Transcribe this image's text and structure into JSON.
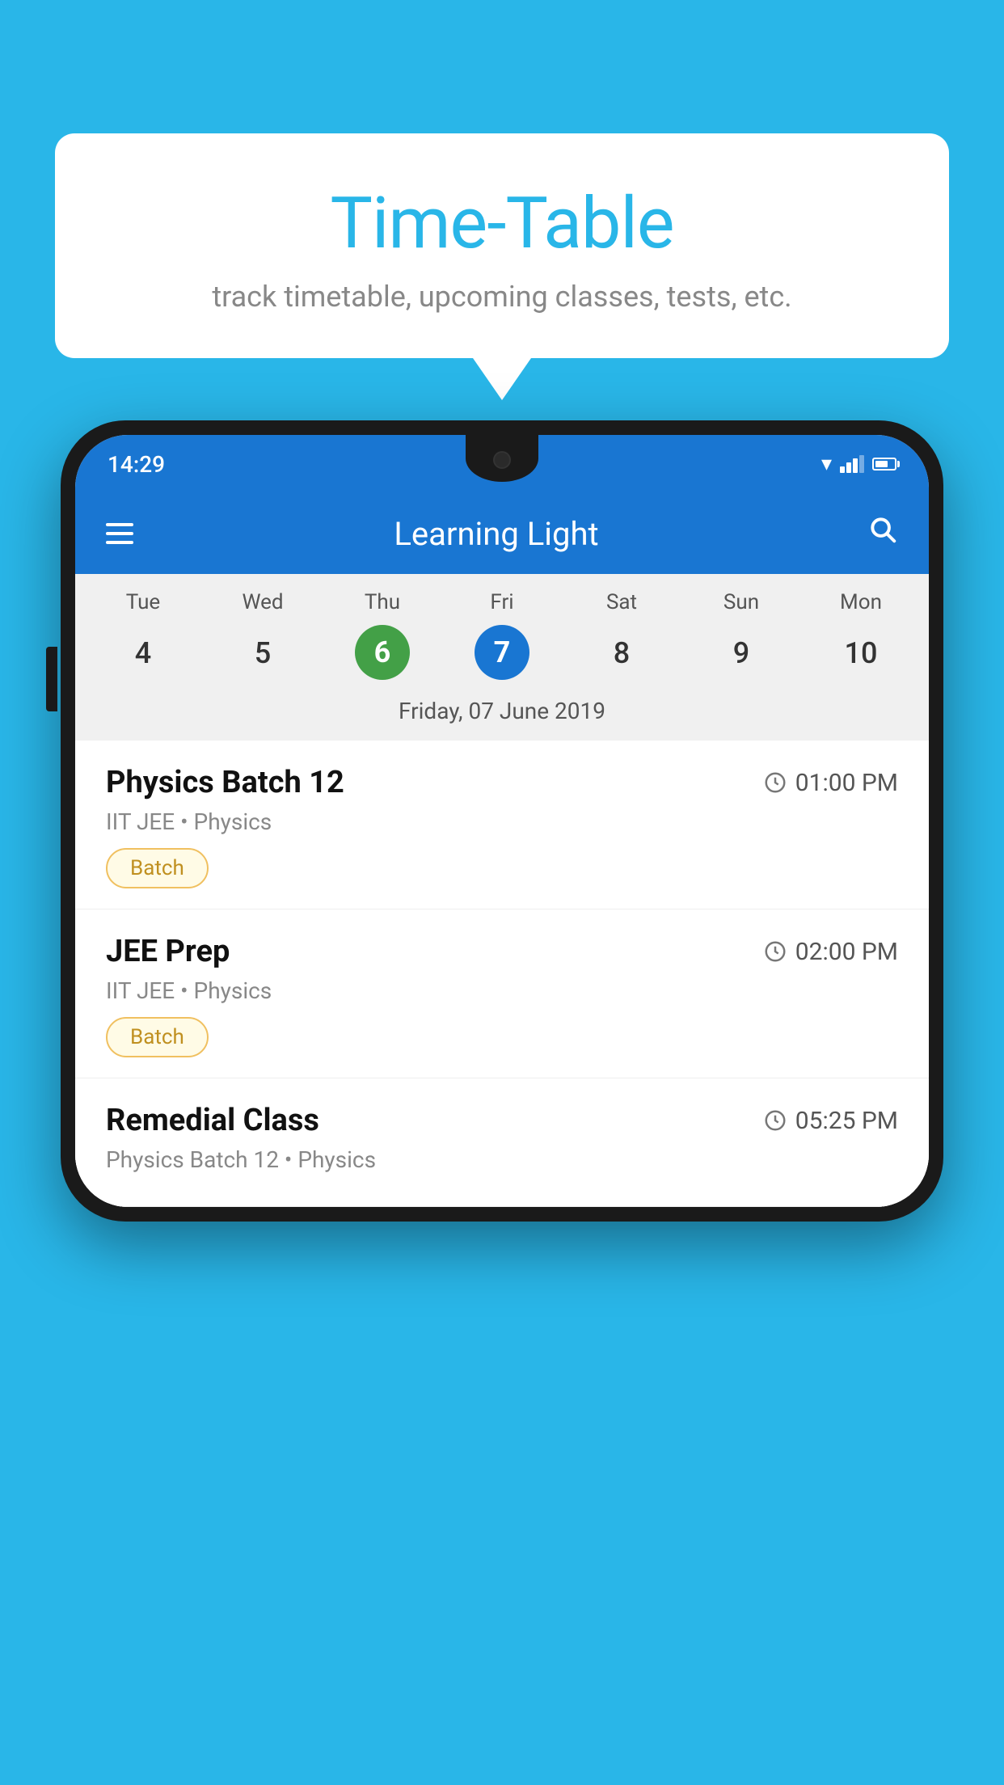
{
  "background_color": "#29b6e8",
  "bubble": {
    "title": "Time-Table",
    "subtitle": "track timetable, upcoming classes, tests, etc."
  },
  "phone": {
    "status_bar": {
      "time": "14:29"
    },
    "app_bar": {
      "title": "Learning Light",
      "hamburger_label": "menu",
      "search_label": "search"
    },
    "calendar": {
      "days": [
        "Tue",
        "Wed",
        "Thu",
        "Fri",
        "Sat",
        "Sun",
        "Mon"
      ],
      "numbers": [
        "4",
        "5",
        "6",
        "7",
        "8",
        "9",
        "10"
      ],
      "today_index": 2,
      "selected_index": 3,
      "selected_date_label": "Friday, 07 June 2019"
    },
    "schedule": [
      {
        "title": "Physics Batch 12",
        "time": "01:00 PM",
        "meta": "IIT JEE • Physics",
        "badge": "Batch"
      },
      {
        "title": "JEE Prep",
        "time": "02:00 PM",
        "meta": "IIT JEE • Physics",
        "badge": "Batch"
      },
      {
        "title": "Remedial Class",
        "time": "05:25 PM",
        "meta": "Physics Batch 12 • Physics",
        "badge": null
      }
    ]
  }
}
